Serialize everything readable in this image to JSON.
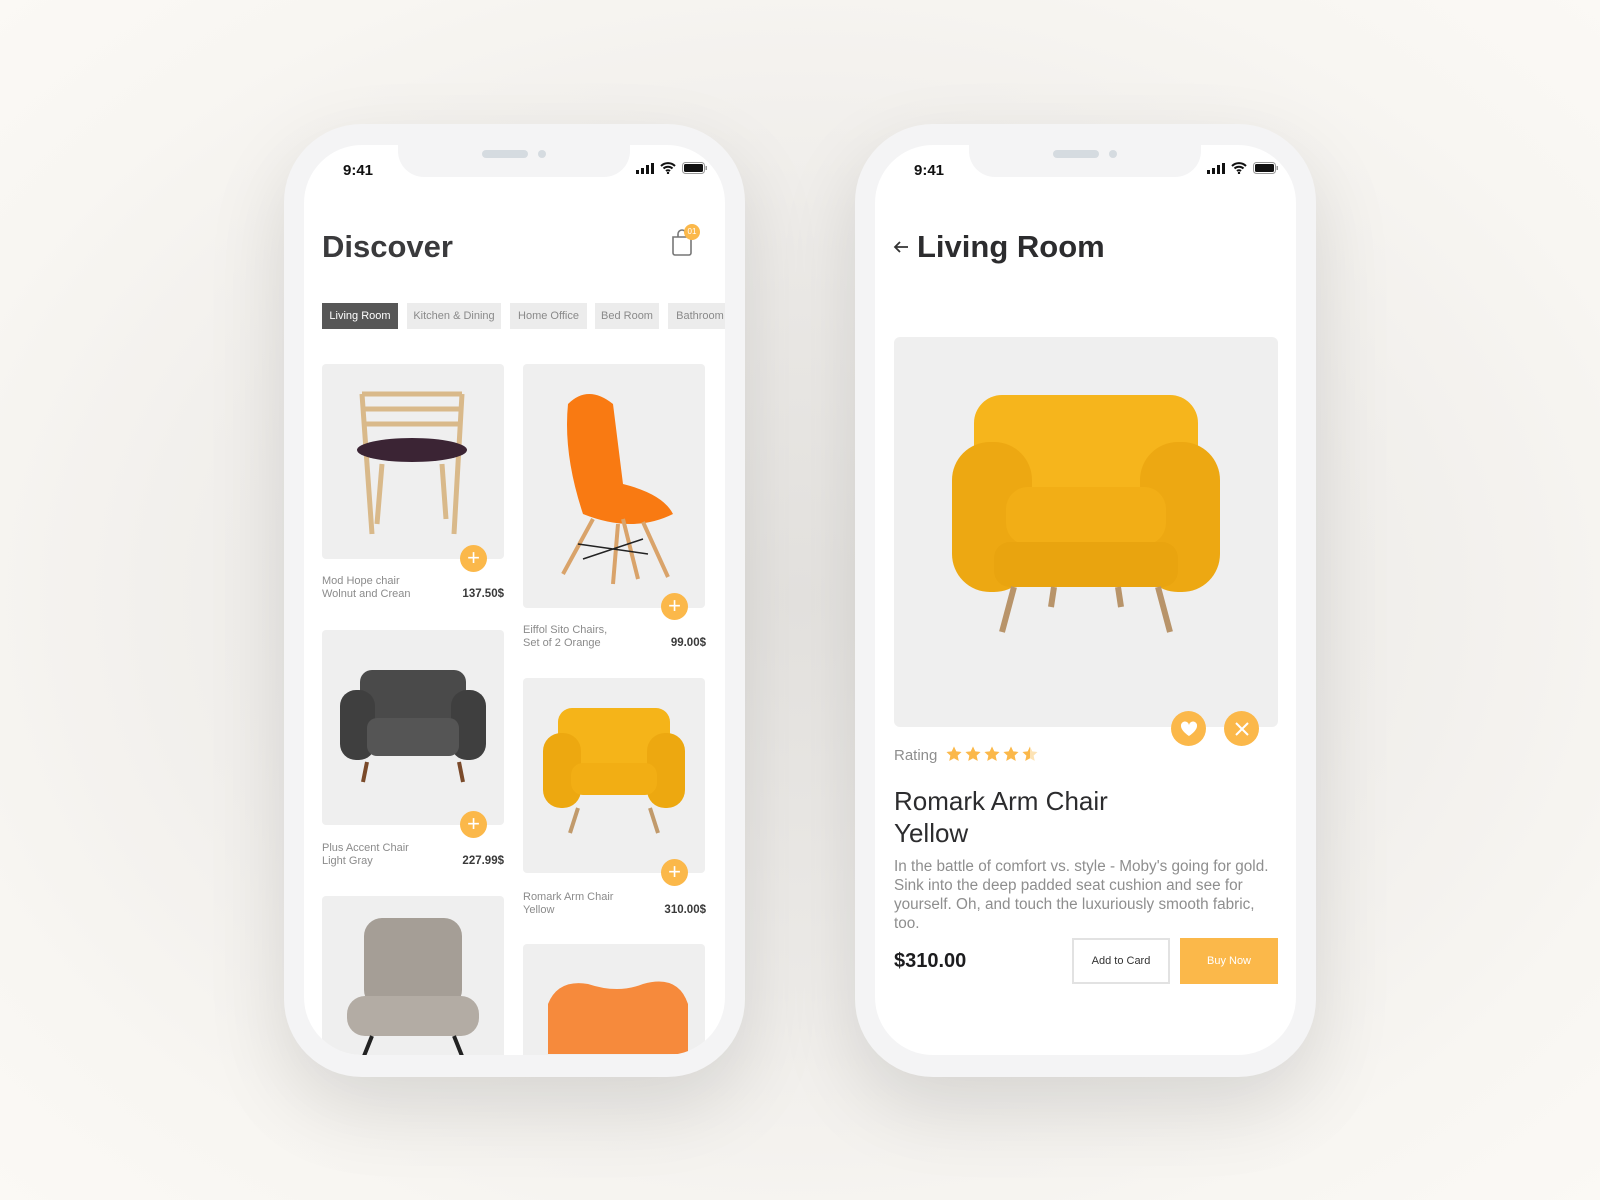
{
  "status_bar": {
    "time": "9:41"
  },
  "discover": {
    "title": "Discover",
    "cart_badge": "01",
    "tabs": [
      {
        "label": "Living Room",
        "active": true
      },
      {
        "label": "Kitchen & Dining"
      },
      {
        "label": "Home Office"
      },
      {
        "label": "Bed Room"
      },
      {
        "label": "Bathroom"
      }
    ],
    "products": [
      {
        "name1": "Mod Hope chair",
        "name2": "Wolnut  and Crean",
        "price": "137.50$"
      },
      {
        "name1": "Eiffol Sito Chairs,",
        "name2": "Set of 2 Orange",
        "price": "99.00$"
      },
      {
        "name1": "Plus Accent Chair",
        "name2": "Light Gray",
        "price": "227.99$"
      },
      {
        "name1": "Romark Arm Chair",
        "name2": "Yellow",
        "price": "310.00$"
      }
    ]
  },
  "detail": {
    "title": "Living Room",
    "rating_label": "Rating",
    "rating": 4.5,
    "rating_max": 5,
    "name1": "Romark Arm Chair",
    "name2": "Yellow",
    "description": "In the battle of comfort vs. style - Moby's going for gold. Sink into the deep padded seat cushion and see for yourself. Oh, and touch the luxuriously smooth fabric, too.",
    "price": "$310.00",
    "add_label": "Add to Card",
    "buy_label": "Buy Now"
  },
  "colors": {
    "accent": "#fbb84a",
    "tab_active": "#575757",
    "card_bg": "#efefef"
  }
}
